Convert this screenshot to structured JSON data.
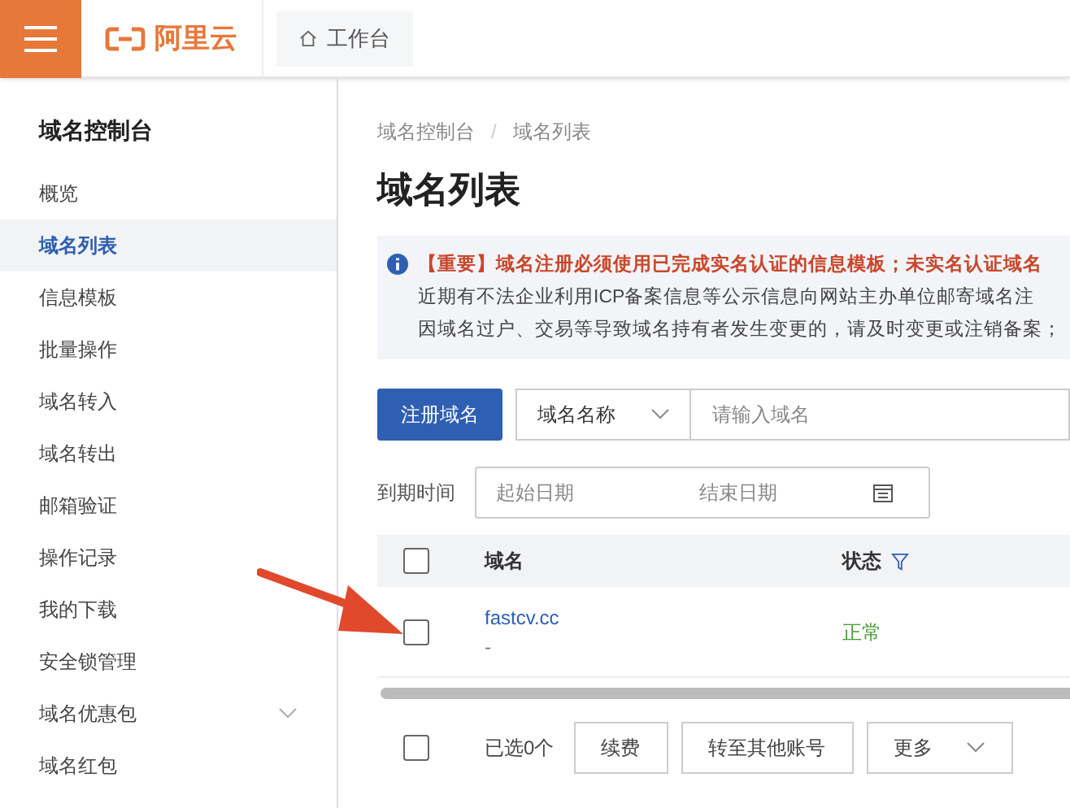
{
  "header": {
    "logo": "阿里云",
    "workbench": "工作台"
  },
  "sidebar": {
    "title": "域名控制台",
    "items": [
      {
        "label": "概览",
        "selected": false
      },
      {
        "label": "域名列表",
        "selected": true
      },
      {
        "label": "信息模板",
        "selected": false
      },
      {
        "label": "批量操作",
        "selected": false
      },
      {
        "label": "域名转入",
        "selected": false
      },
      {
        "label": "域名转出",
        "selected": false
      },
      {
        "label": "邮箱验证",
        "selected": false
      },
      {
        "label": "操作记录",
        "selected": false
      },
      {
        "label": "我的下载",
        "selected": false
      },
      {
        "label": "安全锁管理",
        "selected": false
      },
      {
        "label": "域名优惠包",
        "selected": false,
        "expandable": true
      },
      {
        "label": "域名红包",
        "selected": false
      }
    ]
  },
  "breadcrumb": [
    "域名控制台",
    "域名列表"
  ],
  "breadcrumb_separator": "/",
  "page_title": "域名列表",
  "notice": {
    "important": "【重要】域名注册必须使用已完成实名认证的信息模板；未实名认证域名",
    "lines": [
      "近期有不法企业利用ICP备案信息等公示信息向网站主办单位邮寄域名注",
      "因域名过户、交易等导致域名持有者发生变更的，请及时变更或注销备案；"
    ]
  },
  "toolbar": {
    "register_button": "注册域名",
    "search_type": "域名名称",
    "search": {
      "placeholder": "请输入域名"
    }
  },
  "date_filter": {
    "label": "到期时间",
    "start": {
      "placeholder": "起始日期"
    },
    "end": {
      "placeholder": "结束日期"
    }
  },
  "table": {
    "columns": [
      "域名",
      "状态"
    ],
    "header_checked": false,
    "rows": [
      {
        "domain": "fastcv.cc",
        "note": "-",
        "status": "正常",
        "checked": false
      }
    ]
  },
  "footer": {
    "checked": false,
    "selected_count": "已选0个",
    "buttons": [
      "续费",
      "转至其他账号",
      "更多"
    ]
  }
}
